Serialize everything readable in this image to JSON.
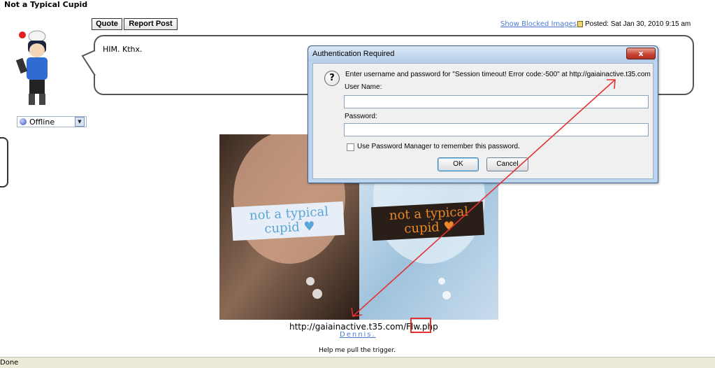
{
  "post": {
    "author": "Not a Typical Cupid",
    "online_status": "Offline",
    "quote_label": "Quote",
    "report_label": "Report Post",
    "show_blocked": "Show Blocked Images",
    "posted": "Posted: Sat Jan 30, 2010 9:15 am",
    "message": "HIM. Kthx.",
    "image_text_left": "not a typical cupid ♥",
    "image_text_right": "not a typical cupid ♥",
    "caption_url": "http://gaiainactive.t35.com/Flw.php",
    "caption_link": "Dennis.",
    "signature": "Help me pull the trigger."
  },
  "dialog": {
    "title": "Authentication Required",
    "close": "x",
    "message": "Enter username and password for \"Session timeout! Error code:-500\" at http://gaiainactive.t35.com",
    "user_label": "User Name:",
    "user_value": "",
    "password_label": "Password:",
    "password_value": "",
    "remember_label": "Use Password Manager to remember this password.",
    "ok": "OK",
    "cancel": "Cancel"
  },
  "statusbar": {
    "text": "Done"
  },
  "colors": {
    "link": "#4a7bd3",
    "annotation": "#e53030",
    "dialog_frame": "#bcd3ee"
  },
  "icons": [
    "question-icon",
    "close-icon",
    "posted-doc-icon",
    "online-status-icon",
    "dropdown-arrow-icon"
  ]
}
